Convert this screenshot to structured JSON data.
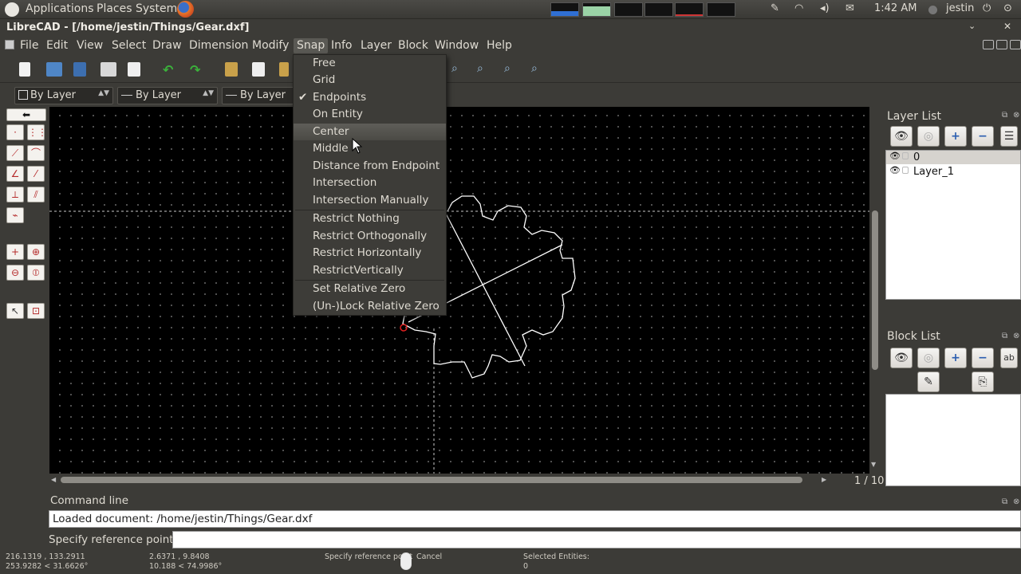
{
  "panel": {
    "applications": "Applications",
    "places": "Places",
    "system": "System",
    "clock": "1:42 AM",
    "user": "jestin"
  },
  "window": {
    "title": "LibreCAD - [/home/jestin/Things/Gear.dxf]"
  },
  "menubar": {
    "items": [
      "File",
      "Edit",
      "View",
      "Select",
      "Draw",
      "Dimension",
      "Modify",
      "Snap",
      "Info",
      "Layer",
      "Block",
      "Window",
      "Help"
    ],
    "active": "Snap"
  },
  "penbar": {
    "color": "By Layer",
    "width": "By Layer",
    "type": "By Layer"
  },
  "snap_menu": {
    "items": [
      {
        "label": "Free",
        "checked": false
      },
      {
        "label": "Grid",
        "checked": false
      },
      {
        "label": "Endpoints",
        "checked": true
      },
      {
        "label": "On Entity",
        "checked": false
      },
      {
        "label": "Center",
        "checked": false,
        "highlighted": true
      },
      {
        "label": "Middle",
        "checked": false
      },
      {
        "label": "Distance from Endpoint",
        "checked": false
      },
      {
        "label": "Intersection",
        "checked": false
      },
      {
        "label": "Intersection Manually",
        "checked": false
      },
      {
        "label": "Restrict Nothing",
        "checked": false
      },
      {
        "label": "Restrict Orthogonally",
        "checked": false
      },
      {
        "label": "Restrict Horizontally",
        "checked": false
      },
      {
        "label": "RestrictVertically",
        "checked": false
      },
      {
        "label": "Set Relative Zero",
        "checked": false
      },
      {
        "label": "(Un-)Lock Relative Zero",
        "checked": false
      }
    ]
  },
  "layer_list": {
    "title": "Layer List",
    "layers": [
      {
        "name": "0",
        "selected": true
      },
      {
        "name": "Layer_1",
        "selected": false
      }
    ]
  },
  "block_list": {
    "title": "Block List"
  },
  "zoom": {
    "grid_spacing": "1 / 10"
  },
  "command": {
    "title": "Command line",
    "history": "Loaded document: /home/jestin/Things/Gear.dxf",
    "prompt": "Specify reference point"
  },
  "status": {
    "abs_coord": "216.1319 , 133.2911",
    "abs_polar": "253.9282 < 31.6626°",
    "rel_coord": "2.6371 , 9.8408",
    "rel_polar": "10.188 < 74.9986°",
    "mouse_left": "Specify reference point",
    "mouse_right": "Cancel",
    "selected_label": "Selected Entities:",
    "selected_count": "0"
  },
  "icons": {
    "accent": "#f07746",
    "ubuntu_logo": "ubuntu-icon",
    "firefox": "firefox-icon"
  }
}
